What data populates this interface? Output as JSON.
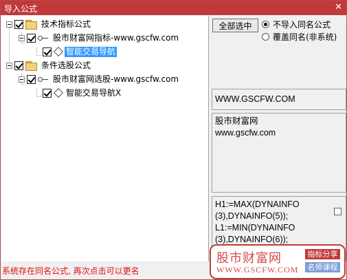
{
  "window": {
    "title": "导入公式",
    "close_glyph": "✕"
  },
  "tree": {
    "nodes": [
      {
        "label": "技术指标公式",
        "checked": true
      },
      {
        "label": "股市财富网指标-www.gscfw.com",
        "checked": true
      },
      {
        "label": "智能交易导航",
        "checked": true,
        "selected": true
      },
      {
        "label": "条件选股公式",
        "checked": true
      },
      {
        "label": "股市财富网选股-www.gscfw.com",
        "checked": true
      },
      {
        "label": "智能交易导航X",
        "checked": true
      }
    ]
  },
  "options": {
    "select_all_label": "全部选中",
    "radio_skip_label": "不导入同名公式",
    "radio_overwrite_label": "覆盖同名(非系统)",
    "selected": "skip"
  },
  "info": {
    "url": "WWW.GSCFW.COM",
    "desc_line1": "股市财富网",
    "desc_line2": "www.gscfw.com"
  },
  "code": {
    "lines": [
      "H1:=MAX(DYNAINFO",
      "(3),DYNAINFO(5));",
      "L1:=MIN(DYNAINFO",
      "(3),DYNAINFO(6));"
    ]
  },
  "status": {
    "text": "系统存在同名公式, 再次点击可以更名"
  },
  "watermark": {
    "name": "股市财富网",
    "site": "WWW.GSCFW.COM",
    "tag1": "指标分享",
    "tag2": "名师课程"
  },
  "colors": {
    "title_bar": "#c2393b",
    "selection": "#3399ff",
    "status_text": "#dd1111"
  }
}
